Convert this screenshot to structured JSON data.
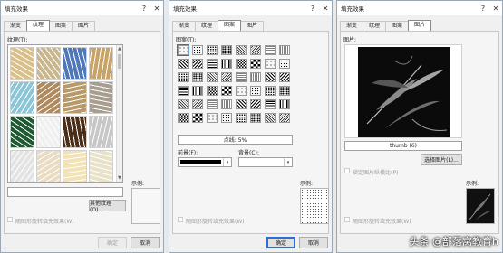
{
  "dialogs": [
    {
      "title": "填充效果",
      "tabs": [
        "渐变",
        "纹理",
        "图案",
        "图片"
      ],
      "active_tab": 1,
      "section_label": "纹理(T):",
      "other_button": "其他纹理(O)...",
      "sample_label": "示例:",
      "rotate_checkbox": "随图形旋转填充效果(W)",
      "ok": "确定",
      "cancel": "取消"
    },
    {
      "title": "填充效果",
      "tabs": [
        "渐变",
        "纹理",
        "图案",
        "图片"
      ],
      "active_tab": 2,
      "section_label": "图案(T):",
      "pattern_name": "点线: 5%",
      "foreground_label": "前景(F):",
      "background_label": "背景(C):",
      "sample_label": "示例:",
      "rotate_checkbox": "随图形旋转填充效果(W)",
      "ok": "确定",
      "cancel": "取消"
    },
    {
      "title": "填充效果",
      "tabs": [
        "渐变",
        "纹理",
        "图案",
        "图片"
      ],
      "active_tab": 3,
      "section_label": "图片:",
      "picture_name": "thumb (6)",
      "select_button": "选择图片(L)...",
      "lock_checkbox": "锁定图片纵横比(P)",
      "sample_label": "示例:",
      "rotate_checkbox": "随图形旋转填充效果(W)",
      "ok": "确定",
      "cancel": "取消"
    }
  ],
  "watermark": "头条 @部落窝教育h",
  "colors": {
    "foreground": "#000000",
    "background": "#ffffff",
    "default_button_border": "#2b6fd6"
  },
  "texture_colors": [
    "#d9c08a",
    "#c9b68c",
    "#4f78b8",
    "#c8a366",
    "#8cc6d6",
    "#b08a5f",
    "#b89a6a",
    "#a89e90",
    "#1f5a33",
    "#f0f0f0",
    "#4a2e18",
    "#c7c7c9",
    "#e3e3e3",
    "#eadbc3",
    "#f1e3b6",
    "#e8e2c9"
  ]
}
